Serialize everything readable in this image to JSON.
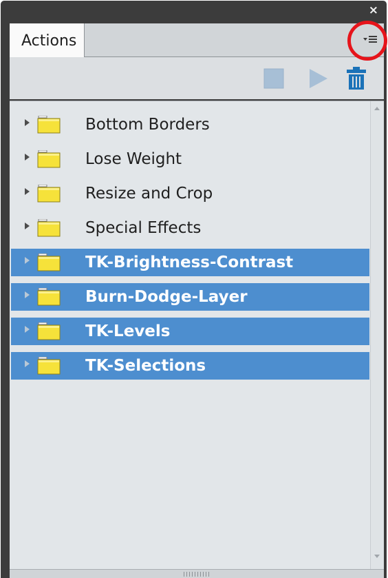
{
  "panel": {
    "close_glyph": "×",
    "tab_label": "Actions",
    "menu_icon": "panel-menu-icon",
    "highlight_color": "#e6141b"
  },
  "toolbar": {
    "buttons": [
      {
        "icon": "stop-icon",
        "state": "disabled"
      },
      {
        "icon": "play-icon",
        "state": "disabled"
      },
      {
        "icon": "trash-icon",
        "state": "enabled"
      }
    ]
  },
  "actions": {
    "items": [
      {
        "label": "Bottom Borders",
        "selected": false
      },
      {
        "label": "Lose Weight",
        "selected": false
      },
      {
        "label": "Resize and Crop",
        "selected": false
      },
      {
        "label": "Special Effects",
        "selected": false
      },
      {
        "label": "TK-Brightness-Contrast",
        "selected": true
      },
      {
        "label": "Burn-Dodge-Layer",
        "selected": true
      },
      {
        "label": "TK-Levels",
        "selected": true
      },
      {
        "label": "TK-Selections",
        "selected": true
      }
    ]
  },
  "colors": {
    "selection": "#4d8ecf",
    "folder": "#f6e23a",
    "trash": "#1b72b8"
  }
}
